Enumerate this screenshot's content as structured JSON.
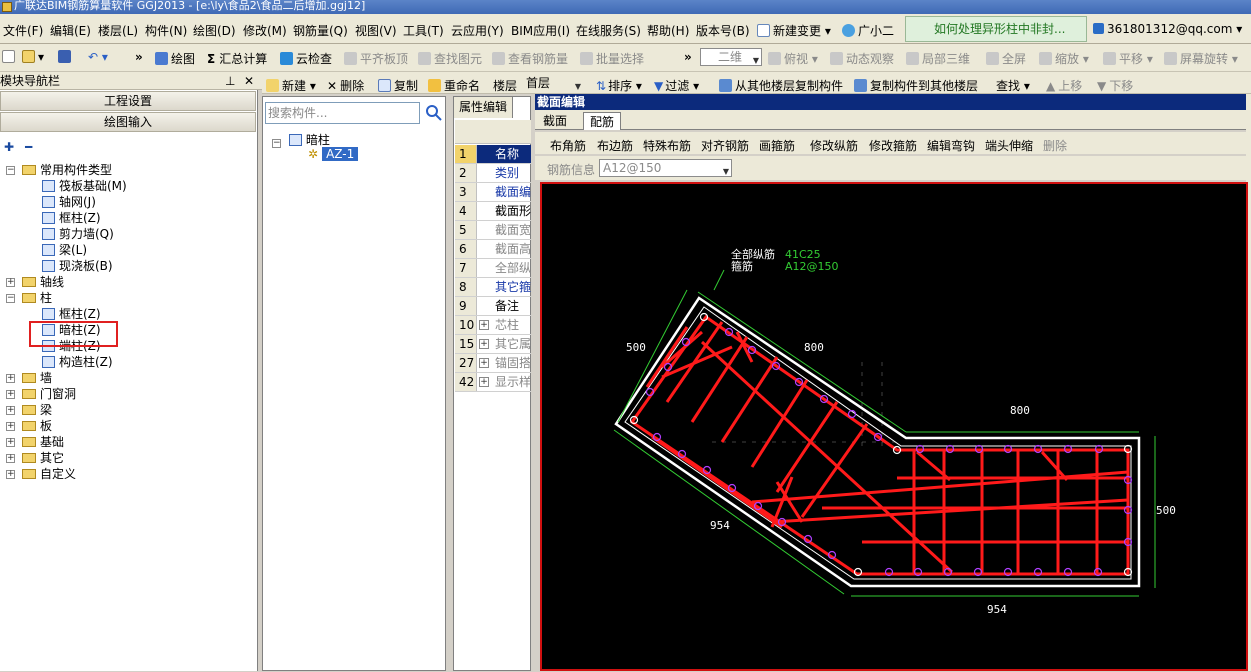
{
  "window": {
    "title": "广联达BIM钢筋算量软件 GGJ2013 - [e:\\ly\\食品2\\食品二后增加.ggj12]"
  },
  "menu": [
    "文件(F)",
    "编辑(E)",
    "楼层(L)",
    "构件(N)",
    "绘图(D)",
    "修改(M)",
    "钢筋量(Q)",
    "视图(V)",
    "工具(T)",
    "云应用(Y)",
    "BIM应用(I)",
    "在线服务(S)",
    "帮助(H)",
    "版本号(B)",
    "新建变更",
    "广小二"
  ],
  "menu_notice": "如何处理异形柱中非封...",
  "user": "361801312@qq.com",
  "toolbar": {
    "draw": "绘图",
    "sum": "汇总计算",
    "cloud_check": "云检查",
    "flat_roof": "平齐板顶",
    "find_elem": "查找图元",
    "view_rebar": "查看钢筋量",
    "batch_select": "批量选择",
    "view2d": "二维",
    "topview": "俯视",
    "dynamic_view": "动态观察",
    "local3d": "局部三维",
    "fullscreen": "全屏",
    "zoom": "缩放",
    "pan": "平移",
    "rotate": "屏幕旋转"
  },
  "toolbar2": {
    "new": "新建",
    "delete": "删除",
    "copy": "复制",
    "rename": "重命名",
    "floor_label": "楼层",
    "floor_value": "首层",
    "sort": "排序",
    "filter": "过滤",
    "copy_from": "从其他楼层复制构件",
    "copy_to": "复制构件到其他楼层",
    "find": "查找",
    "up": "上移",
    "down": "下移"
  },
  "nav": {
    "title": "模块导航栏",
    "btn_project": "工程设置",
    "btn_draw": "绘图输入",
    "tree": [
      {
        "label": "常用构件类型",
        "level": 0,
        "folder": true,
        "exp": "−"
      },
      {
        "label": "筏板基础(M)",
        "level": 1
      },
      {
        "label": "轴网(J)",
        "level": 1
      },
      {
        "label": "框柱(Z)",
        "level": 1
      },
      {
        "label": "剪力墙(Q)",
        "level": 1
      },
      {
        "label": "梁(L)",
        "level": 1
      },
      {
        "label": "现浇板(B)",
        "level": 1
      },
      {
        "label": "轴线",
        "level": 0,
        "folder": true,
        "exp": "+"
      },
      {
        "label": "柱",
        "level": 0,
        "folder": true,
        "exp": "−"
      },
      {
        "label": "框柱(Z)",
        "level": 1
      },
      {
        "label": "暗柱(Z)",
        "level": 1
      },
      {
        "label": "端柱(Z)",
        "level": 1
      },
      {
        "label": "构造柱(Z)",
        "level": 1
      },
      {
        "label": "墙",
        "level": 0,
        "folder": true,
        "exp": "+"
      },
      {
        "label": "门窗洞",
        "level": 0,
        "folder": true,
        "exp": "+"
      },
      {
        "label": "梁",
        "level": 0,
        "folder": true,
        "exp": "+"
      },
      {
        "label": "板",
        "level": 0,
        "folder": true,
        "exp": "+"
      },
      {
        "label": "基础",
        "level": 0,
        "folder": true,
        "exp": "+"
      },
      {
        "label": "其它",
        "level": 0,
        "folder": true,
        "exp": "+"
      },
      {
        "label": "自定义",
        "level": 0,
        "folder": true,
        "exp": "+"
      }
    ]
  },
  "list": {
    "search_placeholder": "搜索构件...",
    "root": "暗柱",
    "item": "AZ-1"
  },
  "props": {
    "tab": "属性编辑",
    "rows": [
      {
        "num": "1",
        "name": "名称",
        "style": "sel"
      },
      {
        "num": "2",
        "name": "类别",
        "style": "blue"
      },
      {
        "num": "3",
        "name": "截面编",
        "style": "blue"
      },
      {
        "num": "4",
        "name": "截面形",
        "style": "black"
      },
      {
        "num": "5",
        "name": "截面宽",
        "style": "gray"
      },
      {
        "num": "6",
        "name": "截面高",
        "style": "gray"
      },
      {
        "num": "7",
        "name": "全部纵",
        "style": "gray"
      },
      {
        "num": "8",
        "name": "其它箍",
        "style": "blue"
      },
      {
        "num": "9",
        "name": "备注",
        "style": "black"
      },
      {
        "num": "10",
        "name": "芯柱",
        "style": "exp"
      },
      {
        "num": "15",
        "name": "其它属",
        "style": "exp"
      },
      {
        "num": "27",
        "name": "锚固搭",
        "style": "exp"
      },
      {
        "num": "42",
        "name": "显示样",
        "style": "exp"
      }
    ]
  },
  "editor": {
    "title": "截面编辑",
    "tabs": [
      "截面",
      "配筋"
    ],
    "tools": [
      "布角筋",
      "布边筋",
      "特殊布筋",
      "对齐钢筋",
      "画箍筋",
      "修改纵筋",
      "修改箍筋",
      "编辑弯钩",
      "端头伸缩",
      "删除"
    ],
    "rebar_label": "钢筋信息",
    "rebar_value": "A12@150"
  },
  "drawing": {
    "label_long": "全部纵筋",
    "value_long": "41C25",
    "label_stirrup": "箍筋",
    "value_stirrup": "A12@150",
    "dim_500_left": "500",
    "dim_800_diag": "800",
    "dim_800_top": "800",
    "dim_500_right": "500",
    "dim_954_left": "954",
    "dim_954_bottom": "954"
  },
  "colors": {
    "rebar": "#ff1a1a",
    "outline": "#ffffff",
    "dim": "#33cc33",
    "bar_dot": "#b040ff",
    "canvas_bg": "#000000"
  }
}
